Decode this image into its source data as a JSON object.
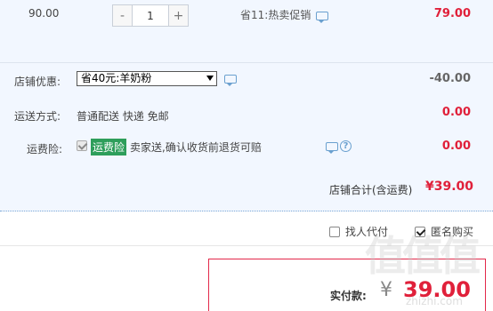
{
  "item": {
    "price": "90.00",
    "quantity": {
      "minus": "-",
      "value": "1",
      "plus": "+"
    },
    "promotion": "省11:热卖促销",
    "promotion_icon": "message-icon",
    "amount": "79.00"
  },
  "shop": {
    "discount": {
      "label": "店铺优惠:",
      "selected": "省40元:羊奶粉",
      "amount": "-40.00"
    },
    "shipping": {
      "label": "运送方式:",
      "value": "普通配送 快递 免邮",
      "amount": "0.00"
    },
    "insurance": {
      "label": "运费险:",
      "badge": "运费险",
      "text": "卖家送,确认收货前退货可赔",
      "help": "?",
      "amount": "0.00"
    },
    "total": {
      "label": "店铺合计(含运费)",
      "value": "¥39.00"
    }
  },
  "options": {
    "pay_for_me": {
      "label": "找人代付",
      "checked": false
    },
    "anonymous": {
      "label": "匿名购买",
      "checked": true
    }
  },
  "payment": {
    "label": "实付款:",
    "currency": "¥",
    "amount": "39.00"
  },
  "watermark": {
    "text": "值值值",
    "subtext": "zhizhi.com"
  },
  "colors": {
    "accent_red": "#e0203a",
    "badge_green": "#2e9e5b",
    "panel_bg": "#f2f7ff",
    "link_blue": "#6aa0cf"
  }
}
